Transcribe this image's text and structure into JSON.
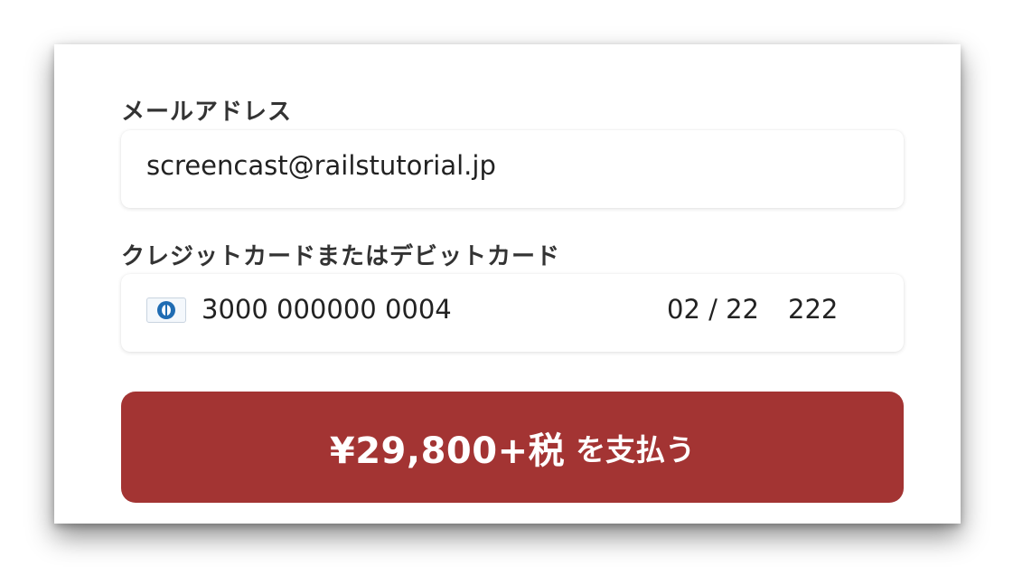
{
  "form": {
    "email_label": "メールアドレス",
    "email_value": "screencast@railstutorial.jp",
    "card_label": "クレジットカードまたはデビットカード",
    "card_brand_icon": "diners-club-card-icon",
    "card_number": "3000 000000 0004",
    "card_expiry": "02 / 22",
    "card_cvc": "222"
  },
  "pay_button": {
    "amount": "¥29,800+税",
    "suffix": "を支払う"
  },
  "colors": {
    "button_background": "#a33433",
    "button_text": "#ffffff",
    "label_text": "#333333",
    "brand_icon": "#1f6cb3"
  }
}
